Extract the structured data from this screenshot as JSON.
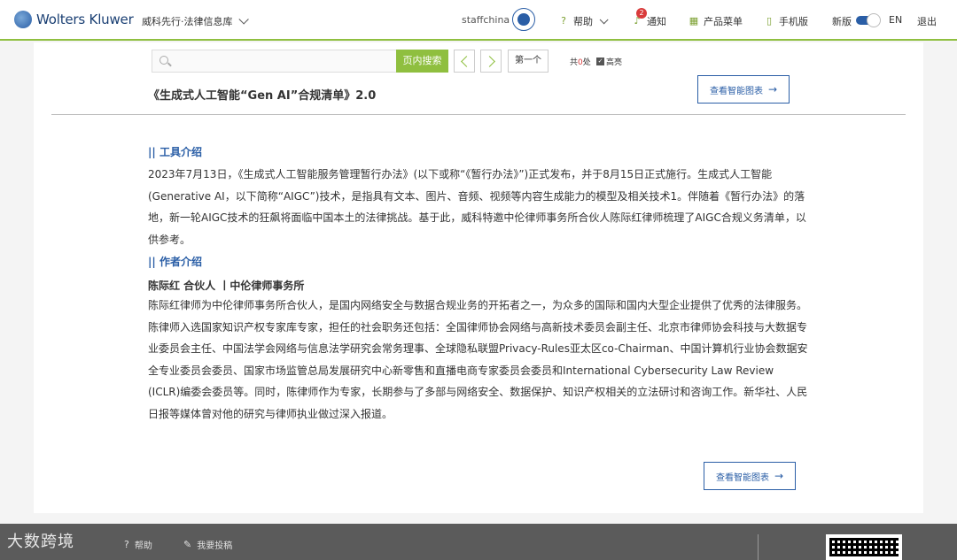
{
  "header": {
    "brand": "Wolters Kluwer",
    "product": "威科先行·法律信息库",
    "username": "staffchina",
    "help": "帮助",
    "notify": "通知",
    "notify_count": "2",
    "product_menu": "产品菜单",
    "mobile": "手机版",
    "new_version": "新版",
    "lang": "EN",
    "logout": "退出"
  },
  "search": {
    "placeholder": "",
    "button": "页内搜索",
    "first": "第一个",
    "count_prefix": "共",
    "count_value": "0",
    "count_suffix": "处",
    "highlight": "高亮"
  },
  "document": {
    "title": "《生成式人工智能“Gen AI”合规清单》2.0",
    "chart_button": "查看智能图表",
    "tool_heading": "|| 工具介绍",
    "tool_text": "2023年7月13日，《生成式人工智能服务管理暂行办法》(以下或称“《暂行办法》”)正式发布，并于8月15日正式施行。生成式人工智能(Generative AI，以下简称“AIGC”)技术，是指具有文本、图片、音频、视频等内容生成能力的模型及相关技术1。伴随着《暂行办法》的落地，新一轮AIGC技术的狂飙将面临中国本土的法律挑战。基于此，威科特邀中伦律师事务所合伙人陈际红律师梳理了AIGC合规义务清单，以供参考。",
    "author_heading": "|| 作者介绍",
    "author_line": "陈际红 合伙人 丨中伦律师事务所",
    "author_text": "陈际红律师为中伦律师事务所合伙人，是国内网络安全与数据合规业务的开拓者之一，为众多的国际和国内大型企业提供了优秀的法律服务。陈律师入选国家知识产权专家库专家，担任的社会职务还包括：全国律师协会网络与高新技术委员会副主任、北京市律师协会科技与大数据专业委员会主任、中国法学会网络与信息法学研究会常务理事、全球隐私联盟Privacy-Rules亚太区co-Chairman、中国计算机行业协会数据安全专业委员会委员、国家市场监管总局发展研究中心新零售和直播电商专家委员会委员和International Cybersecurity Law Review (ICLR)编委会委员等。同时，陈律师作为专家，长期参与了多部与网络安全、数据保护、知识产权相关的立法研讨和咨询工作。新华社、人民日报等媒体曾对他的研究与律师执业做过深入报道。"
  },
  "footer": {
    "watermark": "大数跨境",
    "help": "帮助",
    "submit": "我要投稿"
  }
}
